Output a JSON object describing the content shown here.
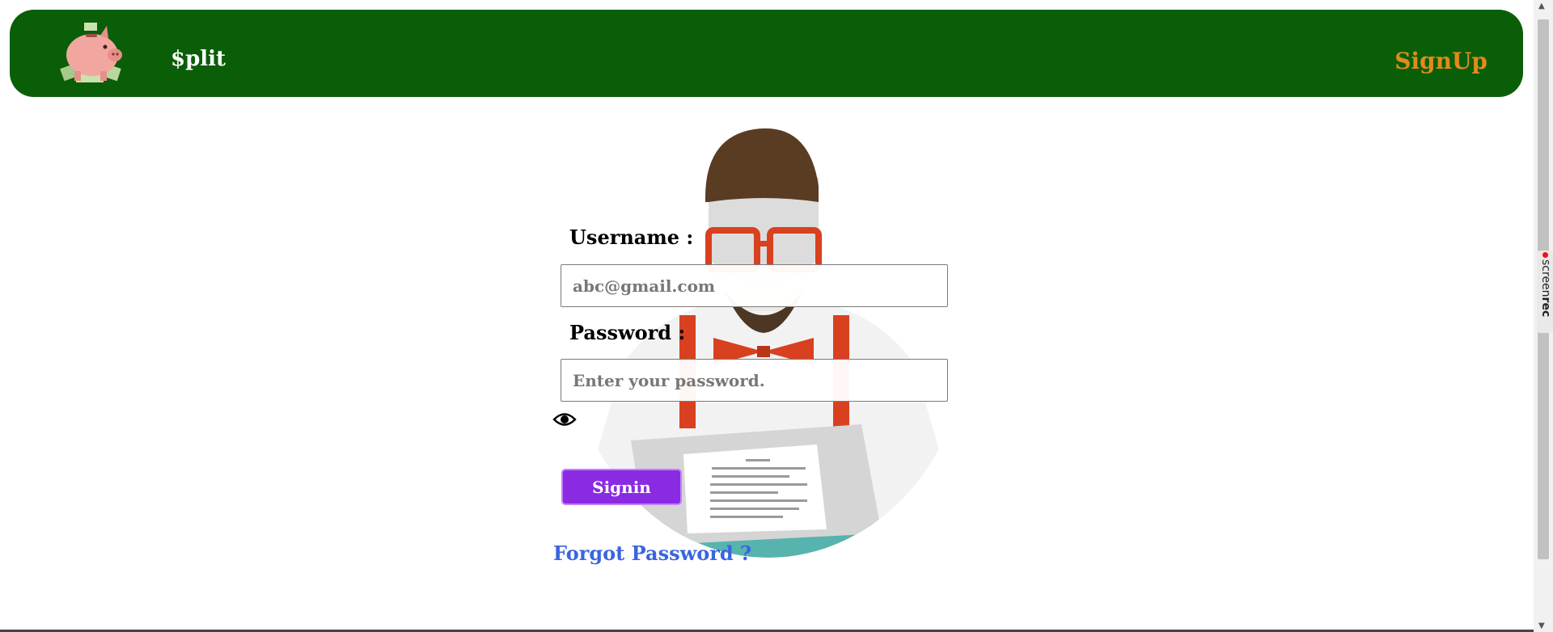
{
  "header": {
    "logo_icon": "piggy-bank-icon",
    "brand": "$plit",
    "signup_label": "SignUp",
    "bg_color": "#0b5e08",
    "signup_color": "#e08a1e"
  },
  "form": {
    "username_label": "Username :",
    "username_placeholder": "abc@gmail.com",
    "password_label": "Password :",
    "password_placeholder": "Enter your password.",
    "show_password_icon": "eye-icon",
    "signin_label": "Signin",
    "signin_color": "#8a2be2",
    "forgot_label": "Forgot Password ?",
    "forgot_color": "#3a64e0"
  },
  "illustration": "man-reading-document-illustration",
  "screenrec": {
    "prefix": "screen",
    "suffix": "rec"
  }
}
